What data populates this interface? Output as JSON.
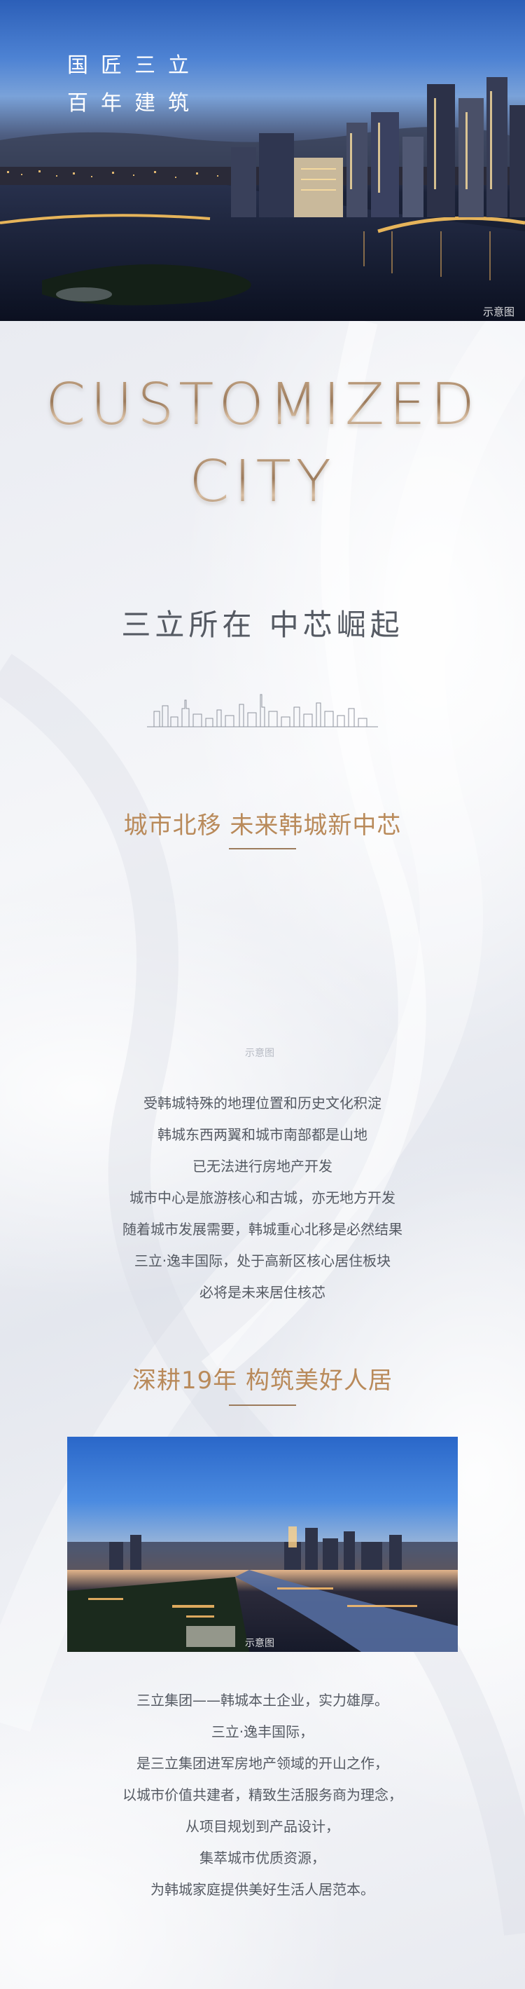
{
  "hero": {
    "line1": "国匠三立",
    "line2": "百年建筑",
    "caption": "示意图"
  },
  "headline": {
    "line1": "CUSTOMIZED",
    "line2": "CITY"
  },
  "subtitle": "三立所在  中芯崛起",
  "section1": {
    "title": "城市北移  未来韩城新中芯",
    "caption": "示意图",
    "paragraphs": [
      "受韩城特殊的地理位置和历史文化积淀",
      "韩城东西两翼和城市南部都是山地",
      "已无法进行房地产开发",
      "城市中心是旅游核心和古城，亦无地方开发",
      "随着城市发展需要，韩城重心北移是必然结果",
      "三立·逸丰国际，处于高新区核心居住板块",
      "必将是未来居住核芯"
    ]
  },
  "section2": {
    "title": "深耕19年  构筑美好人居",
    "caption": "示意图",
    "paragraphs": [
      "三立集团——韩城本土企业，实力雄厚。",
      "三立·逸丰国际，",
      "是三立集团进军房地产领域的开山之作，",
      "以城市价值共建者，精致生活服务商为理念，",
      "从项目规划到产品设计，",
      "集萃城市优质资源，",
      "为韩城家庭提供美好生活人居范本。"
    ]
  },
  "colors": {
    "accent_gold": "#b98a5a",
    "text_gray": "#555a63"
  }
}
